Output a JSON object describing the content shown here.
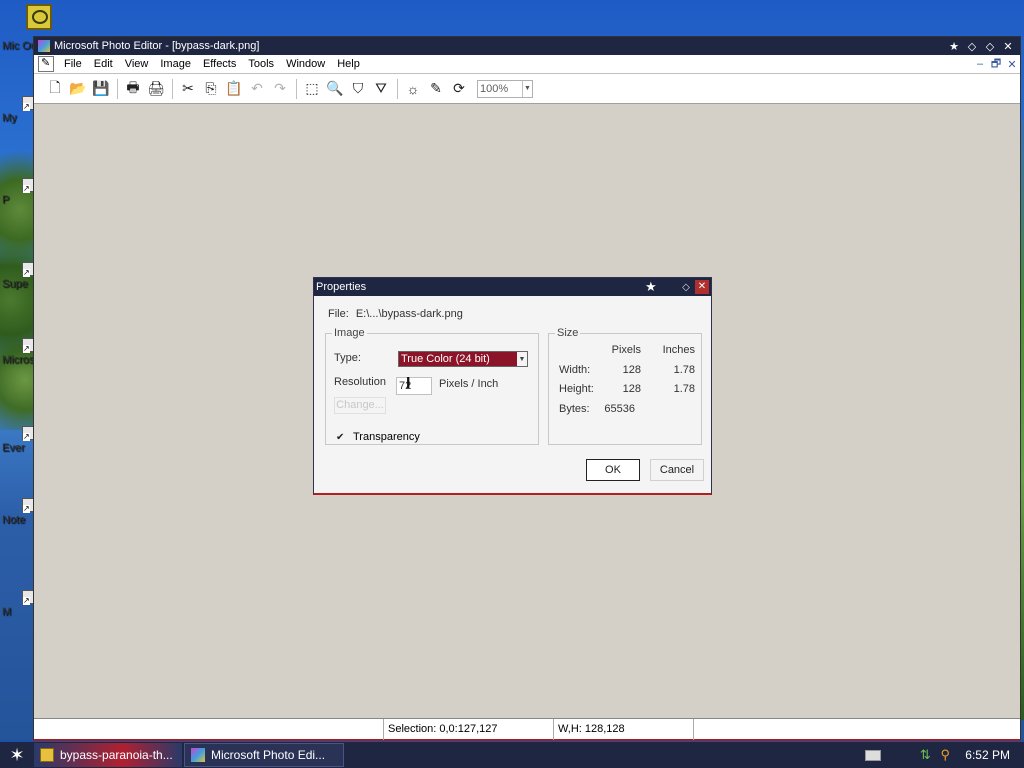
{
  "desktop": {
    "icons": [
      {
        "label": "Mic Ou"
      },
      {
        "label": "My"
      },
      {
        "label": "P"
      },
      {
        "label": "Supe"
      },
      {
        "label": "Microsc Studi"
      },
      {
        "label": "Ever"
      },
      {
        "label": "Note"
      },
      {
        "label": "M"
      }
    ]
  },
  "window": {
    "title": "Microsoft Photo Editor - [bypass-dark.png]",
    "title_buttons": [
      "★",
      "◇",
      "◇",
      "✕"
    ],
    "menu": [
      "File",
      "Edit",
      "View",
      "Image",
      "Effects",
      "Tools",
      "Window",
      "Help"
    ],
    "doc_controls": [
      "–",
      "🗗",
      "✕"
    ],
    "toolbar": {
      "buttons": [
        {
          "icon": "new-icon",
          "glyph": "🗋",
          "disabled": false
        },
        {
          "icon": "open-icon",
          "glyph": "📂",
          "disabled": false
        },
        {
          "icon": "save-icon",
          "glyph": "💾",
          "disabled": true
        },
        {
          "icon": "print-icon",
          "glyph": "🖶",
          "disabled": false
        },
        {
          "icon": "scan-icon",
          "glyph": "🖨",
          "disabled": false
        },
        {
          "icon": "cut-icon",
          "glyph": "✂",
          "disabled": false
        },
        {
          "icon": "copy-icon",
          "glyph": "⎘",
          "disabled": false
        },
        {
          "icon": "paste-icon",
          "glyph": "📋",
          "disabled": true
        },
        {
          "icon": "undo-icon",
          "glyph": "↶",
          "disabled": true
        },
        {
          "icon": "redo-icon",
          "glyph": "↷",
          "disabled": true
        },
        {
          "icon": "select-icon",
          "glyph": "⬚",
          "disabled": false
        },
        {
          "icon": "zoom-icon",
          "glyph": "🔍",
          "disabled": false
        },
        {
          "icon": "crop-icon",
          "glyph": "⛉",
          "disabled": false
        },
        {
          "icon": "smudge-icon",
          "glyph": "⛛",
          "disabled": false
        },
        {
          "icon": "brightness-icon",
          "glyph": "☼",
          "disabled": false
        },
        {
          "icon": "pen-icon",
          "glyph": "✎",
          "disabled": false
        },
        {
          "icon": "rotate-icon",
          "glyph": "⟳",
          "disabled": false
        }
      ],
      "zoom_value": "100%"
    },
    "status": {
      "selection": "Selection: 0,0:127,127",
      "size": "W,H: 128,128"
    }
  },
  "dialog": {
    "title": "Properties",
    "file_label": "File:",
    "file_value": "E:\\...\\bypass-dark.png",
    "image_group": "Image",
    "type_label": "Type:",
    "type_value": "True Color (24 bit)",
    "resolution_label": "Resolution",
    "resolution_value": "72",
    "resolution_unit": "Pixels / Inch",
    "change_button": "Change...",
    "transparency_label": "Transparency",
    "transparency_checked": true,
    "size_group": "Size",
    "col_pixels": "Pixels",
    "col_inches": "Inches",
    "width_label": "Width:",
    "width_pixels": "128",
    "width_inches": "1.78",
    "height_label": "Height:",
    "height_pixels": "128",
    "height_inches": "1.78",
    "bytes_label": "Bytes:",
    "bytes_value": "65536",
    "ok": "OK",
    "cancel": "Cancel"
  },
  "taskbar": {
    "tasks": [
      {
        "label": "bypass-paranoia-th..."
      },
      {
        "label": "Microsoft Photo Edi..."
      }
    ],
    "clock": "6:52 PM"
  }
}
